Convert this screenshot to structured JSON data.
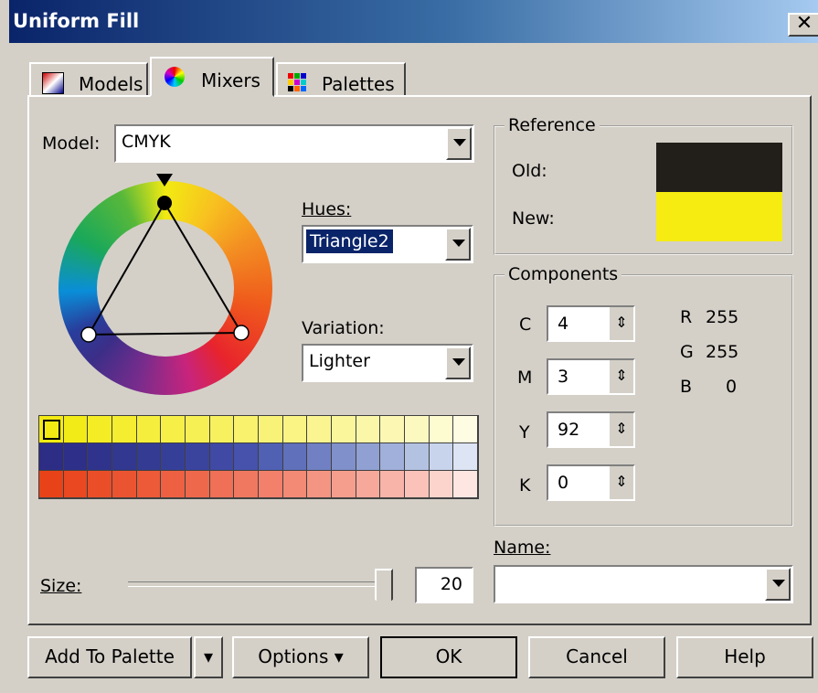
{
  "window": {
    "title": "Uniform Fill",
    "close_glyph": "✕"
  },
  "tabs": [
    {
      "label": "Models",
      "icon": "models-icon"
    },
    {
      "label": "Mixers",
      "icon": "mixers-icon"
    },
    {
      "label": "Palettes",
      "icon": "palettes-icon"
    }
  ],
  "model": {
    "label": "Model:",
    "value": "CMYK"
  },
  "hues": {
    "label": "Hues:",
    "value": "Triangle2"
  },
  "variation": {
    "label": "Variation:",
    "value": "Lighter"
  },
  "reference": {
    "title": "Reference",
    "old_label": "Old:",
    "new_label": "New:",
    "old_color": "#221f1b",
    "new_color": "#f6ec12"
  },
  "components": {
    "title": "Components",
    "c": {
      "label": "C",
      "value": "4"
    },
    "m": {
      "label": "M",
      "value": "3"
    },
    "y": {
      "label": "Y",
      "value": "92"
    },
    "k": {
      "label": "K",
      "value": "0"
    },
    "r": {
      "label": "R",
      "value": "255"
    },
    "g": {
      "label": "G",
      "value": "255"
    },
    "b": {
      "label": "B",
      "value": "0"
    }
  },
  "name_field": {
    "label": "Name:",
    "value": ""
  },
  "size": {
    "label": "Size:",
    "value": "20"
  },
  "swatches": {
    "rows": [
      {
        "name": "yellow",
        "colors": [
          "#f2ea12",
          "#f3eb18",
          "#f4ec24",
          "#f4ed30",
          "#f5ee3c",
          "#f6ef48",
          "#f6f054",
          "#f7f160",
          "#f8f26c",
          "#f8f378",
          "#f9f484",
          "#faf590",
          "#faf69c",
          "#fbf7a8",
          "#fcf8b4",
          "#fcf9c0",
          "#fdfbd0",
          "#fefde4"
        ]
      },
      {
        "name": "indigo",
        "colors": [
          "#2d2d86",
          "#2e2f89",
          "#30338c",
          "#32378f",
          "#343b93",
          "#363f98",
          "#3a449d",
          "#4049a4",
          "#4652ab",
          "#5060b3",
          "#6070ba",
          "#7080c2",
          "#8090ca",
          "#90a0d2",
          "#a0b0da",
          "#b4c2e2",
          "#c8d4ec",
          "#dde4f4"
        ]
      },
      {
        "name": "orange",
        "colors": [
          "#e84318",
          "#e94820",
          "#ea4e28",
          "#eb5430",
          "#ec5a38",
          "#ed6142",
          "#ee684c",
          "#ef7056",
          "#f07860",
          "#f2806a",
          "#f38a76",
          "#f49482",
          "#f59e8e",
          "#f6a89a",
          "#f8b4a8",
          "#fac2b8",
          "#fcd4cc",
          "#fee6e2"
        ]
      }
    ]
  },
  "buttons": {
    "add_to_palette": "Add To Palette",
    "options": "Options",
    "ok": "OK",
    "cancel": "Cancel",
    "help": "Help"
  }
}
